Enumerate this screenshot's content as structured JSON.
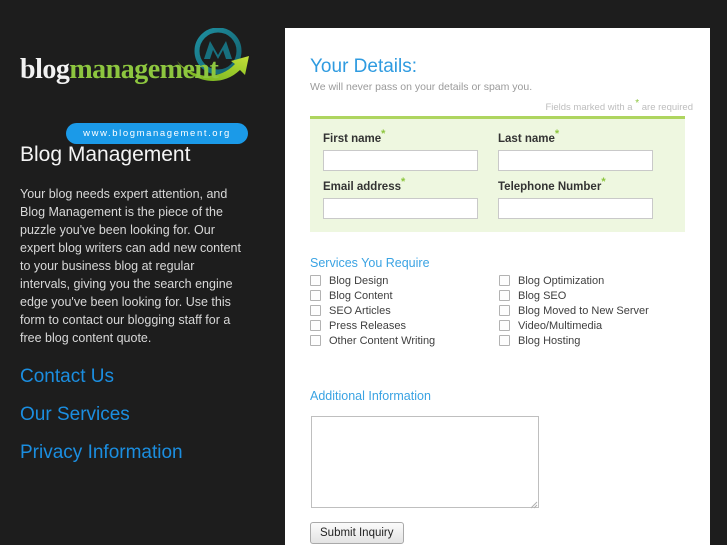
{
  "site": {
    "logo": {
      "word_primary": "blog",
      "word_secondary": "management",
      "url_pill": "www.blogmanagement.org"
    },
    "sidebar": {
      "heading": "Blog Management",
      "body": "Your blog needs expert attention, and Blog Management is the piece of the puzzle you've been looking for. Our expert blog writers can add new content to your business blog at regular intervals, giving you the search engine edge you've been looking for. Use this form to contact our blogging staff for a free blog content quote.",
      "nav": [
        {
          "label": "Contact Us"
        },
        {
          "label": "Our Services"
        },
        {
          "label": "Privacy Information"
        }
      ]
    }
  },
  "form": {
    "title": "Your Details:",
    "subtitle": "We will never pass on your details or spam you.",
    "required_note_before": "Fields marked with a",
    "required_note_after": "are required",
    "required_marker": "*",
    "fields": [
      {
        "label": "First name",
        "required": true,
        "value": "",
        "placeholder": ""
      },
      {
        "label": "Last name",
        "required": true,
        "value": "",
        "placeholder": ""
      },
      {
        "label": "Email address",
        "required": true,
        "value": "",
        "placeholder": ""
      },
      {
        "label": "Telephone Number",
        "required": true,
        "value": "",
        "placeholder": ""
      }
    ],
    "services": {
      "title": "Services You Require",
      "left_column": [
        {
          "label": "Blog Design",
          "checked": false
        },
        {
          "label": "Blog Content",
          "checked": false
        },
        {
          "label": "SEO Articles",
          "checked": false
        },
        {
          "label": "Press Releases",
          "checked": false
        },
        {
          "label": "Other Content Writing",
          "checked": false
        }
      ],
      "right_column": [
        {
          "label": "Blog Optimization",
          "checked": false
        },
        {
          "label": "Blog SEO",
          "checked": false
        },
        {
          "label": "Blog Moved to New Server",
          "checked": false
        },
        {
          "label": "Video/Multimedia",
          "checked": false
        },
        {
          "label": "Blog Hosting",
          "checked": false
        }
      ]
    },
    "additional": {
      "title": "Additional Information",
      "value": "",
      "placeholder": ""
    },
    "submit_label": "Submit Inquiry"
  },
  "colors": {
    "page_background": "#1d1d1d",
    "panel_background": "#ffffff",
    "accent_blue": "#2f9be0",
    "link_blue": "#1b8ee0",
    "accent_green": "#8dc63f",
    "details_box_background": "#eef7e0",
    "details_box_border": "#aed55f",
    "logo_pill_blue": "#1b9ae8",
    "logo_mark_teal": "#1b7f8e"
  }
}
